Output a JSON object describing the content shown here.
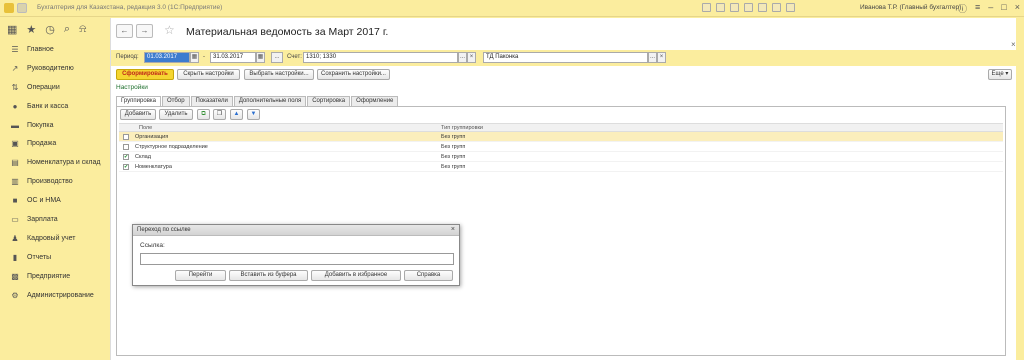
{
  "titlebar": {
    "app_title": "Бухгалтерия для Казахстана, редакция 3.0  (1С:Предприятие)",
    "user": "Иванова Т.Р. (Главный бухгалтер)"
  },
  "sidebar": {
    "items": [
      {
        "label": "Главное",
        "icon": "menu-icon"
      },
      {
        "label": "Руководителю",
        "icon": "trend-icon"
      },
      {
        "label": "Операции",
        "icon": "operations-icon"
      },
      {
        "label": "Банк и касса",
        "icon": "bank-icon"
      },
      {
        "label": "Покупка",
        "icon": "cart-icon"
      },
      {
        "label": "Продажа",
        "icon": "sales-icon"
      },
      {
        "label": "Номенклатура и склад",
        "icon": "warehouse-icon"
      },
      {
        "label": "Производство",
        "icon": "production-icon"
      },
      {
        "label": "ОС и НМА",
        "icon": "assets-icon"
      },
      {
        "label": "Зарплата",
        "icon": "salary-icon"
      },
      {
        "label": "Кадровый учет",
        "icon": "personnel-icon"
      },
      {
        "label": "Отчеты",
        "icon": "reports-icon"
      },
      {
        "label": "Предприятие",
        "icon": "enterprise-icon"
      },
      {
        "label": "Администрирование",
        "icon": "admin-icon"
      }
    ]
  },
  "document": {
    "title": "Материальная ведомость  за Март 2017 г."
  },
  "filters": {
    "period_label": "Период:",
    "period_from": "01.03.2017",
    "period_sep": "-",
    "period_to": "31.03.2017",
    "account_label": "Счет:",
    "account_value": "1310; 1330",
    "warehouse_value": "ТД Паконка",
    "dots": "...",
    "clear": "×"
  },
  "toolbar": {
    "generate": "Сформировать",
    "hide_settings": "Скрыть настройки",
    "choose_settings": "Выбрать настройки...",
    "save_settings": "Сохранить настройки...",
    "more": "Еще ▾"
  },
  "settings_link": "Настройки",
  "tabs": [
    "Группировка",
    "Отбор",
    "Показатели",
    "Дополнительные поля",
    "Сортировка",
    "Оформление"
  ],
  "grid_toolbar": {
    "add": "Добавить",
    "delete": "Удалить"
  },
  "grid": {
    "columns": {
      "field": "Поле",
      "group_type": "Тип группировки"
    },
    "rows": [
      {
        "checked": false,
        "field": "Организация",
        "group_type": "Без групп",
        "highlight": true
      },
      {
        "checked": false,
        "field": "Структурное подразделение",
        "group_type": "Без групп",
        "highlight": false
      },
      {
        "checked": true,
        "field": "Склад",
        "group_type": "Без групп",
        "highlight": false
      },
      {
        "checked": true,
        "field": "Номенклатура",
        "group_type": "Без групп",
        "highlight": false
      }
    ]
  },
  "modal": {
    "title": "Переход по ссылке",
    "label": "Ссылка:",
    "input_value": "",
    "buttons": {
      "go": "Перейти",
      "paste": "Вставить из буфера",
      "add_fav": "Добавить в избранное",
      "help": "Справка"
    }
  },
  "colors": {
    "background": "#fbed9e",
    "accent_button": "#f5d531",
    "selection": "#3d7ccf",
    "settings_link": "#1d6e2c"
  }
}
